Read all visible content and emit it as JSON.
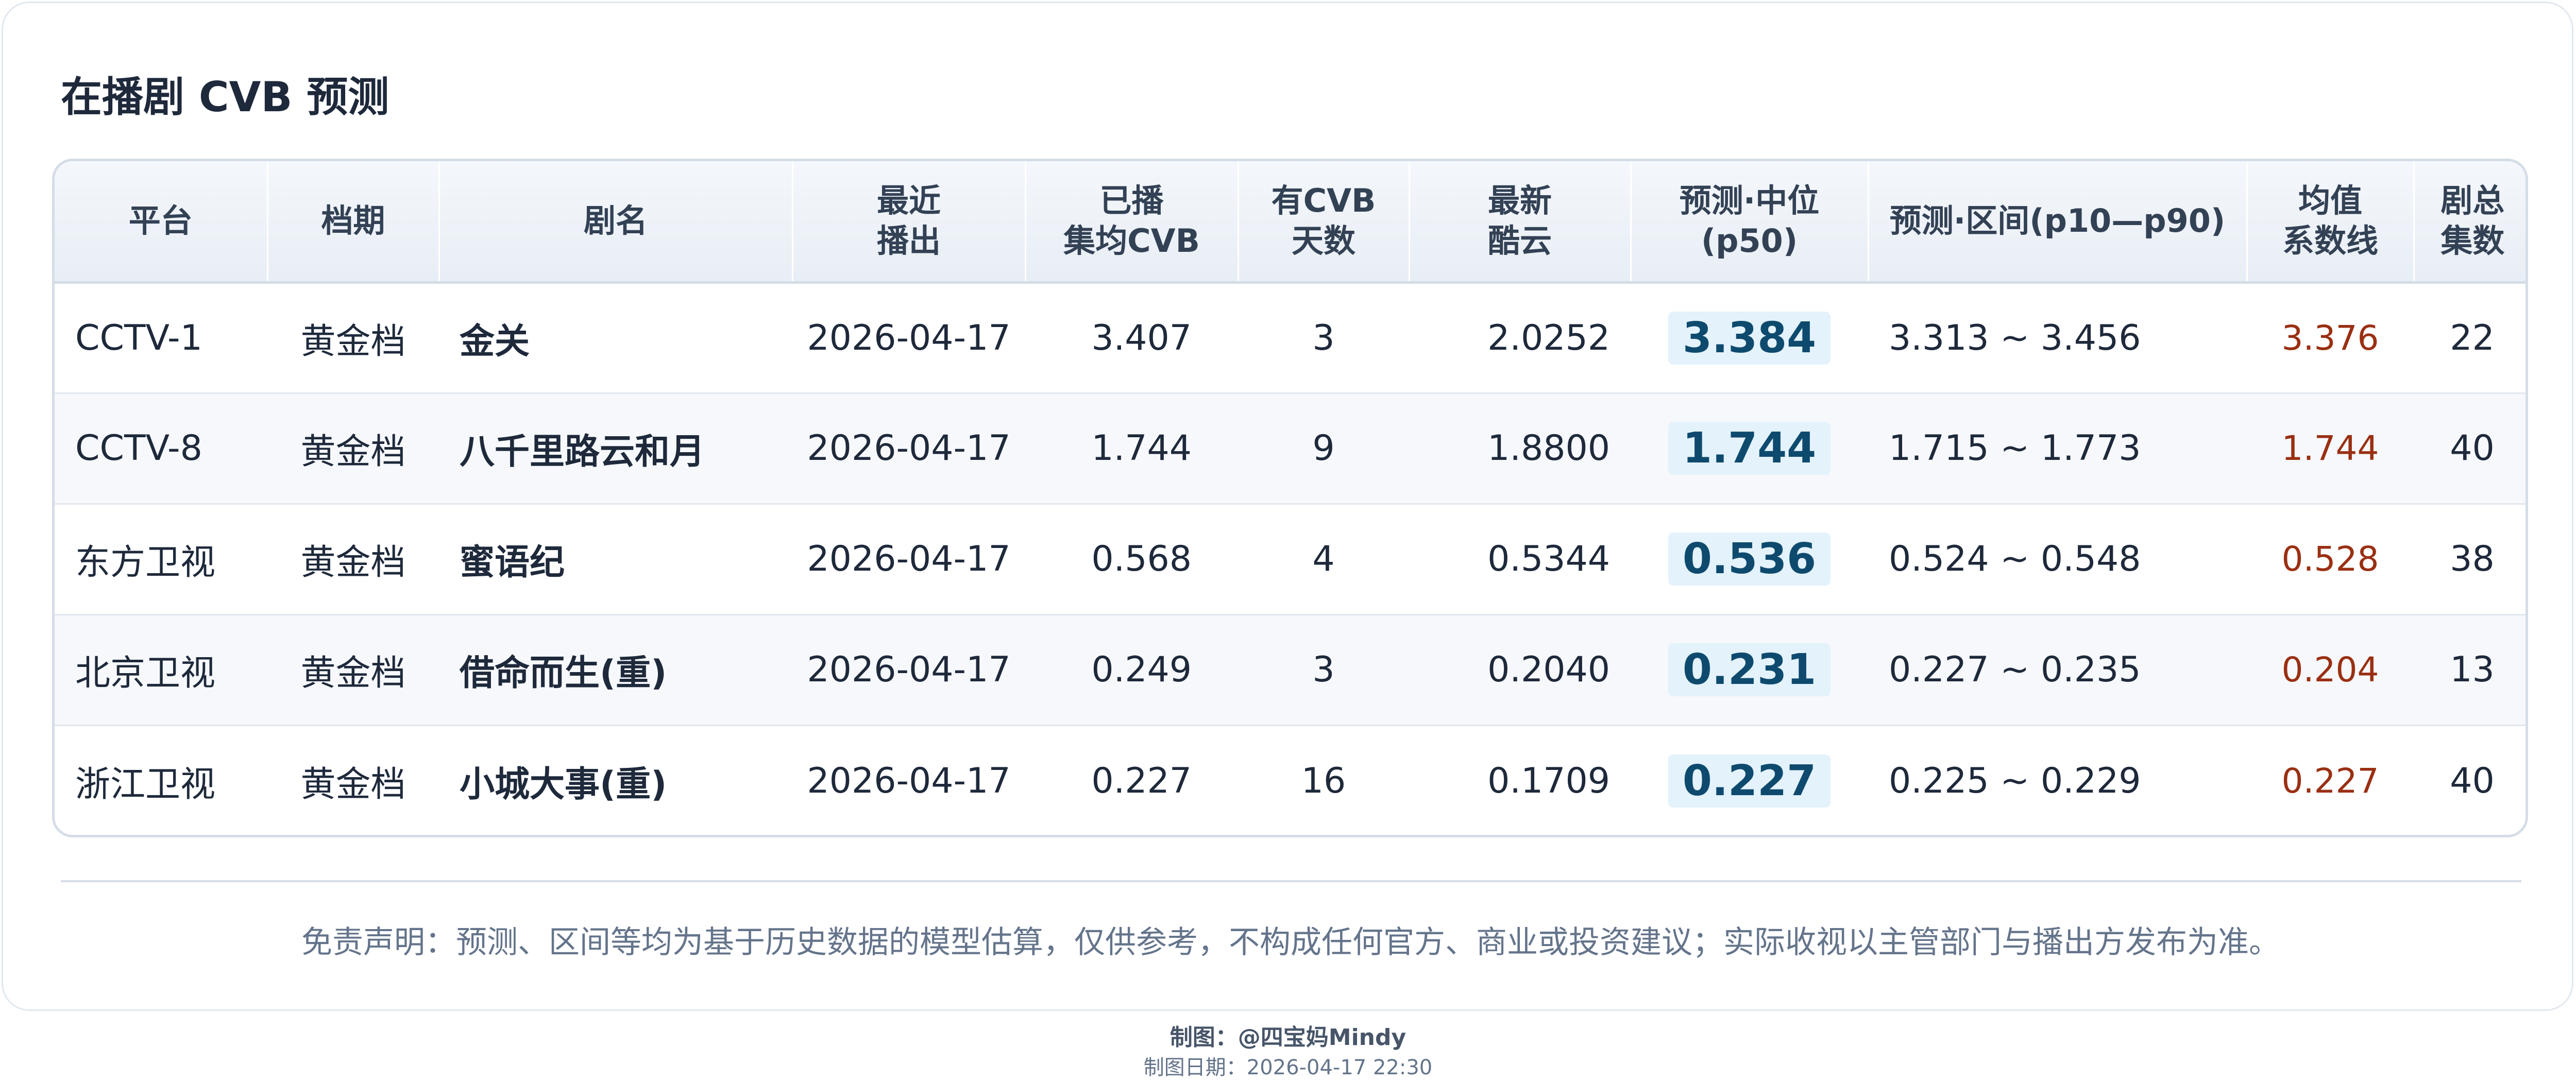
{
  "title": "在播剧 CVB 预测",
  "headers": {
    "platform": "平台",
    "slot": "档期",
    "drama": "剧名",
    "latest_l1": "最近",
    "latest_l2": "播出",
    "avg_l1": "已播",
    "avg_l2": "集均CVB",
    "days_l1": "有CVB",
    "days_l2": "天数",
    "kuyun_l1": "最新",
    "kuyun_l2": "酷云",
    "median_l1": "预测·中位",
    "median_l2": "(p50)",
    "range": "预测·区间(p10—p90)",
    "mean_l1": "均值",
    "mean_l2": "系数线",
    "eps_l1": "剧总",
    "eps_l2": "集数"
  },
  "rows": [
    {
      "platform": "CCTV-1",
      "slot": "黄金档",
      "drama": "金关",
      "latest": "2026-04-17",
      "avg_cvb": "3.407",
      "cvb_days": "3",
      "kuyun": "2.0252",
      "median": "3.384",
      "range": "3.313 ~ 3.456",
      "mean_line": "3.376",
      "episodes": "22"
    },
    {
      "platform": "CCTV-8",
      "slot": "黄金档",
      "drama": "八千里路云和月",
      "latest": "2026-04-17",
      "avg_cvb": "1.744",
      "cvb_days": "9",
      "kuyun": "1.8800",
      "median": "1.744",
      "range": "1.715 ~ 1.773",
      "mean_line": "1.744",
      "episodes": "40"
    },
    {
      "platform": "东方卫视",
      "slot": "黄金档",
      "drama": "蜜语纪",
      "latest": "2026-04-17",
      "avg_cvb": "0.568",
      "cvb_days": "4",
      "kuyun": "0.5344",
      "median": "0.536",
      "range": "0.524 ~ 0.548",
      "mean_line": "0.528",
      "episodes": "38"
    },
    {
      "platform": "北京卫视",
      "slot": "黄金档",
      "drama": "借命而生(重)",
      "latest": "2026-04-17",
      "avg_cvb": "0.249",
      "cvb_days": "3",
      "kuyun": "0.2040",
      "median": "0.231",
      "range": "0.227 ~ 0.235",
      "mean_line": "0.204",
      "episodes": "13"
    },
    {
      "platform": "浙江卫视",
      "slot": "黄金档",
      "drama": "小城大事(重)",
      "latest": "2026-04-17",
      "avg_cvb": "0.227",
      "cvb_days": "16",
      "kuyun": "0.1709",
      "median": "0.227",
      "range": "0.225 ~ 0.229",
      "mean_line": "0.227",
      "episodes": "40"
    }
  ],
  "disclaimer": "免责声明：预测、区间等均为基于历史数据的模型估算，仅供参考，不构成任何官方、商业或投资建议；实际收视以主管部门与播出方发布为准。",
  "credit": "制图：@四宝妈Mindy",
  "credit_date": "制图日期：2026-04-17 22:30",
  "colors": {
    "accent_pred_text": "#0e4a6e",
    "accent_pred_bg": "#e3f2fb",
    "mean_line": "#9a2f12",
    "header_bg": "#e8eef5"
  }
}
